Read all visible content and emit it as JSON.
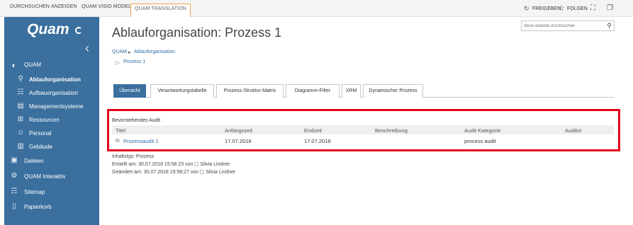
{
  "ribbon": {
    "tabs": [
      "DURCHSUCHEN",
      "ANZEIGEN",
      "QUAM VISIO MODELER",
      "QUAM TRANSLATION"
    ],
    "share_label": "FREIGEBEN",
    "follow_label": "FOLGEN"
  },
  "sidebar": {
    "logo": "Quam",
    "items": [
      {
        "label": "QUAM",
        "icon": "quam-icon"
      },
      {
        "label": "Ablauforganisation",
        "icon": "flow-icon"
      },
      {
        "label": "Aufbauorganisation",
        "icon": "org-chart-icon"
      },
      {
        "label": "Managementsysteme",
        "icon": "management-icon"
      },
      {
        "label": "Ressourcen",
        "icon": "resources-icon"
      },
      {
        "label": "Personal",
        "icon": "people-icon"
      },
      {
        "label": "Gebäude",
        "icon": "building-icon"
      },
      {
        "label": "Dateien",
        "icon": "files-icon"
      },
      {
        "label": "QUAM Interaktiv",
        "icon": "interactive-icon"
      },
      {
        "label": "Sitemap",
        "icon": "sitemap-icon"
      },
      {
        "label": "Papierkorb",
        "icon": "trash-icon"
      }
    ]
  },
  "page": {
    "title": "Ablauforganisation: Prozess 1",
    "search_placeholder": "diese website durchsuchen",
    "breadcrumb": {
      "root": "QUAM",
      "separator": "▸",
      "current": "Ablauforganisation",
      "child": "Prozess 1"
    }
  },
  "tabs": [
    "Übersicht",
    "Verantwortungstabelle",
    "Prozess-Struktur-Matrix",
    "Diagramm-Filter",
    "XRM",
    "Dynamischer Prozess"
  ],
  "audit": {
    "section_title": "Bevorstehendes Audit",
    "columns": [
      "Titel",
      "Anfangszeit",
      "Endzeit",
      "Beschreibung",
      "Audit Kategorie",
      "Auditor"
    ],
    "row": {
      "title": "Prozessaudit 1",
      "start": "17.07.2018",
      "end": "17.07.2018",
      "description": "",
      "category": "process audit",
      "auditor": ""
    }
  },
  "meta": {
    "content_type": "Inhaltstyp: Prozess",
    "created_prefix": "Erstellt am: 30.07.2018 15:58:23 von",
    "created_by": "Silvia Lindner",
    "modified_prefix": "Geändert am: 30.07.2018 15:58:27 von",
    "modified_by": "Silvia Lindner"
  },
  "colors": {
    "accent": "#3a6f9e",
    "highlight_border": "#e3001b",
    "link": "#2e6ea6",
    "active_ribbon_tab": "#e8a44a"
  }
}
